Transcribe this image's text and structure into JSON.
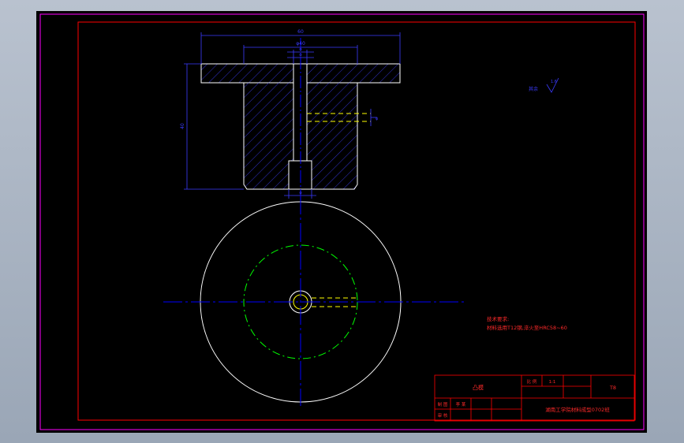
{
  "colors": {
    "background": "#000000",
    "outer_border": "#ff00ff",
    "inner_border": "#ff0000",
    "outline": "#ffffff",
    "dimension": "#3b3bff",
    "centerline": "#0000ff",
    "hatch": "#3333cc",
    "hidden_line": "#ffff00",
    "pitch_circle": "#00ff00",
    "note_text": "#ff2a2a",
    "title_block": "#ff0000"
  },
  "dimensions": {
    "overall_width": "60",
    "mid_width": "φ40",
    "bore_upper": "φ",
    "bore_lower": "φ",
    "height": "40",
    "side_hole": "φ",
    "bottom_bore": "φ"
  },
  "surface_finish": {
    "label": "其余",
    "value": "1.6"
  },
  "notes": {
    "heading": "技术要求:",
    "line1": "材料选用T12钢,淬火至HRC58~60"
  },
  "title_block": {
    "part_name": "凸模",
    "scale_label": "比 例",
    "scale_value": "1:1",
    "material": "T8",
    "drawn_label": "制 图",
    "drawn_name": "李 某",
    "checked_label": "审 核",
    "school": "湖南工学院材料成型0702班"
  }
}
